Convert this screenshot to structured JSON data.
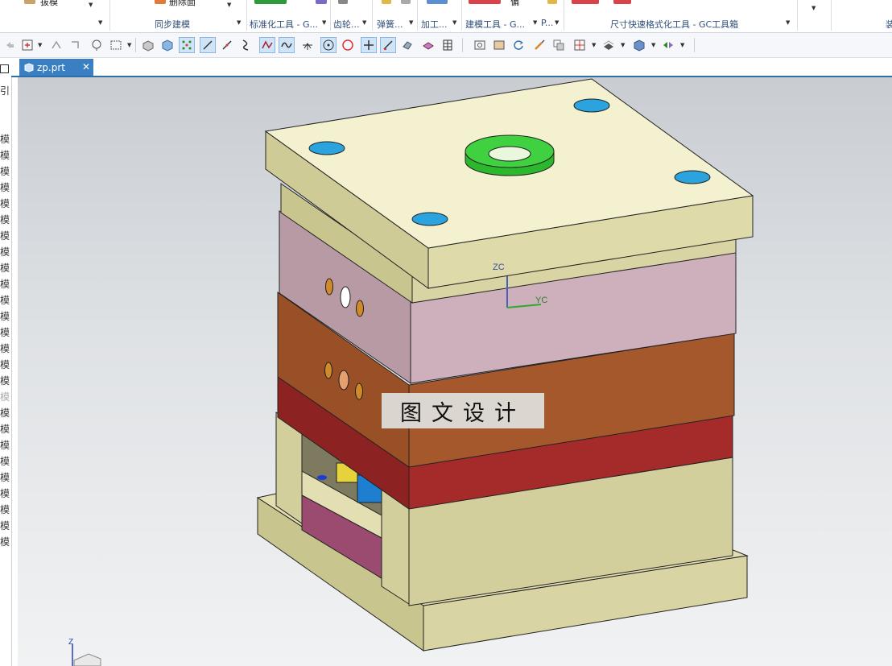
{
  "ribbon": {
    "top_items": [
      {
        "label": "拔模"
      },
      {
        "label": "删除面"
      },
      {
        "label": "偏"
      }
    ],
    "groups": [
      {
        "label": "同步建模"
      },
      {
        "label": "标准化工具 - G..."
      },
      {
        "label": "齿轮..."
      },
      {
        "label": "弹簧..."
      },
      {
        "label": "加工..."
      },
      {
        "label": "建模工具 - G..."
      },
      {
        "label": "P..."
      },
      {
        "label": "尺寸快速格式化工具 - GC工具箱"
      },
      {
        "label": "装"
      }
    ]
  },
  "left_panel": {
    "header": "引",
    "items": [
      "模",
      "模",
      "模",
      "模",
      "模",
      "模",
      "模",
      "模",
      "模",
      "模",
      "模",
      "模",
      "模",
      "模",
      "模",
      "模",
      "模",
      "模",
      "模",
      "模",
      "模",
      "模",
      "模",
      "模",
      "模",
      "模"
    ]
  },
  "tab": {
    "title": "zp.prt",
    "close": "✕"
  },
  "viewport": {
    "axes": {
      "zc": "ZC",
      "yc": "YC",
      "z": "Z"
    },
    "watermark": "图文设计"
  },
  "colors": {
    "accent": "#3a7fc1",
    "plate_cream": "#d6d2a0",
    "plate_pink": "#c9a8b4",
    "plate_orange": "#a4582c",
    "plate_red": "#a52a2a",
    "sprue_green": "#3fd13f",
    "hole_blue": "#2aa3df"
  },
  "toolbar_icons": [
    "undo-icon",
    "select-filter-icon",
    "snap-icon",
    "move-icon",
    "lasso-icon",
    "rect-select-icon",
    "box-icon",
    "cube-icon",
    "grid-points-icon",
    "line-icon",
    "diag-line-icon",
    "curve-icon",
    "spline-icon",
    "wave-icon",
    "intersection-icon",
    "circle-center-icon",
    "circle-icon",
    "plus-icon",
    "slash-icon",
    "rotate-icon",
    "layer-icon",
    "table-icon",
    "fit-view-icon",
    "zoom-icon",
    "refresh-icon",
    "brush-icon",
    "copy-icon",
    "grid-icon",
    "shade-icon",
    "render-icon",
    "filter-icon"
  ]
}
